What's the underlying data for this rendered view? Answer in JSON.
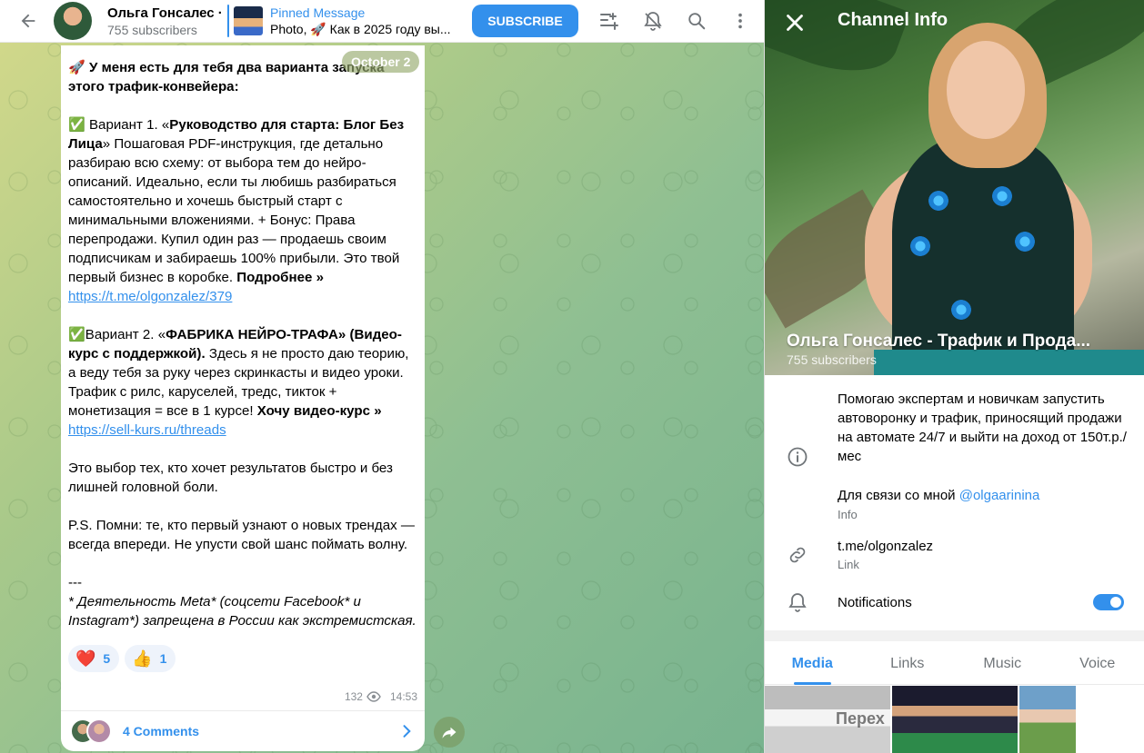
{
  "header": {
    "channel_name": "Ольга Гонсалес ·",
    "subscribers": "755 subscribers",
    "pinned_title": "Pinned Message",
    "pinned_desc": "Photo, 🚀 Как в 2025 году вы...",
    "subscribe_label": "SUBSCRIBE",
    "icons": [
      "back-arrow-icon",
      "poll-icon",
      "bell-muted-icon",
      "search-icon",
      "more-vertical-icon"
    ]
  },
  "message": {
    "date": "October 2",
    "p1a": "🚀 ",
    "p1b": "У меня есть для тебя два варианта запуска этого трафик-конвейера:",
    "v1_prefix": "✅ Вариант 1. «",
    "v1_bold": "Руководство для старта: Блог Без Лица",
    "v1_text": "» Пошаговая PDF-инструкция, где детально разбираю всю схему: от выбора тем до нейро-описаний. Идеально, если ты любишь разбираться самостоятельно и хочешь быстрый старт с минимальными вложениями. + Бонус: Права перепродажи. Купил один раз — продаешь своим подписчикам и забираешь 100% прибыли. Это твой первый бизнес в коробке. ",
    "v1_more": "Подробнее",
    "v1_raquo": " »",
    "v1_link": "https://t.me/olgonzalez/379",
    "v2_prefix": "✅Вариант 2. «",
    "v2_bold": "ФАБРИКА НЕЙРО-ТРАФА» (Видео-курс с поддержкой).",
    "v2_text": " Здесь я не просто даю теорию, а веду тебя за руку через скринкасты и видео уроки. Трафик с рилс, каруселей, тредс, тикток + монетизация = все в 1 курсе! ",
    "v2_want": "Хочу видео-курс",
    "v2_raquo": " » ",
    "v2_link": "https://sell-kurs.ru/threads",
    "p4": "Это выбор тех, кто хочет результатов быстро и без лишней головной боли.",
    "p5": "P.S. Помни: те, кто первый узнают о новых трендах — всегда впереди. Не упусти свой шанс поймать волну.",
    "sep": "---",
    "footnote": "* Деятельность Meta* (соцсети Facebook* и Instagram*) запрещена в России как экстремистская.",
    "reactions": [
      {
        "emoji": "❤️",
        "count": "5"
      },
      {
        "emoji": "👍",
        "count": "1"
      }
    ],
    "views": "132",
    "time": "14:53",
    "comments_label": "4 Comments"
  },
  "info_panel": {
    "title": "Channel Info",
    "name": "Ольга Гонсалес - Трафик и Прода...",
    "subscribers": "755 subscribers",
    "about_1": "Помогаю экспертам и новичкам запустить автоворонку и трафик, приносящий продажи на автомате 24/7 и выйти на доход от 150т.р./мес",
    "about_2": "Для связи со мной ",
    "about_handle": "@olgaarinina",
    "about_caption": "Info",
    "link": "t.me/olgonzalez",
    "link_caption": "Link",
    "notifications_label": "Notifications",
    "notifications_on": true,
    "tabs": [
      "Media",
      "Links",
      "Music",
      "Voice"
    ],
    "media_preview_text": "Перех"
  },
  "colors": {
    "accent": "#3390ec",
    "secondary_text": "#707579"
  }
}
